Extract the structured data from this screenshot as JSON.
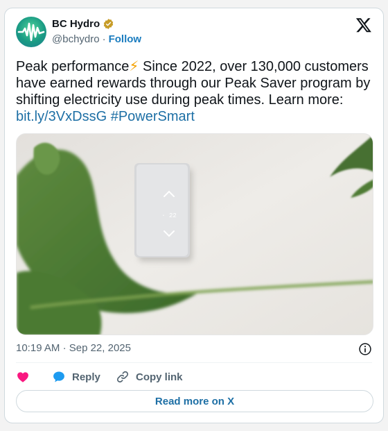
{
  "author": {
    "display_name": "BC Hydro",
    "handle": "@bchydro",
    "separator": "·",
    "follow_label": "Follow",
    "avatar_icon": "bc-hydro-logo-icon",
    "verified_icon": "verified-badge-icon",
    "verified_color": "#c79c27"
  },
  "tweet": {
    "text_part1": "Peak performance",
    "emoji": "⚡",
    "text_part2": " Since 2022, over 130,000 customers have earned rewards through our Peak Saver program by shifting electricity use during peak times. Learn more: ",
    "link_text": "bit.ly/3VxDssG",
    "hashtag": "#PowerSmart"
  },
  "meta": {
    "time": "10:19 AM",
    "separator": "·",
    "date": "Sep 22, 2025"
  },
  "actions": {
    "like_icon": "heart-icon",
    "reply_label": "Reply",
    "copy_label": "Copy link"
  },
  "read_more_label": "Read more on X",
  "colors": {
    "heart": "#f91880",
    "reply_bubble": "#1d9bf0",
    "link": "#1d6fa5"
  }
}
